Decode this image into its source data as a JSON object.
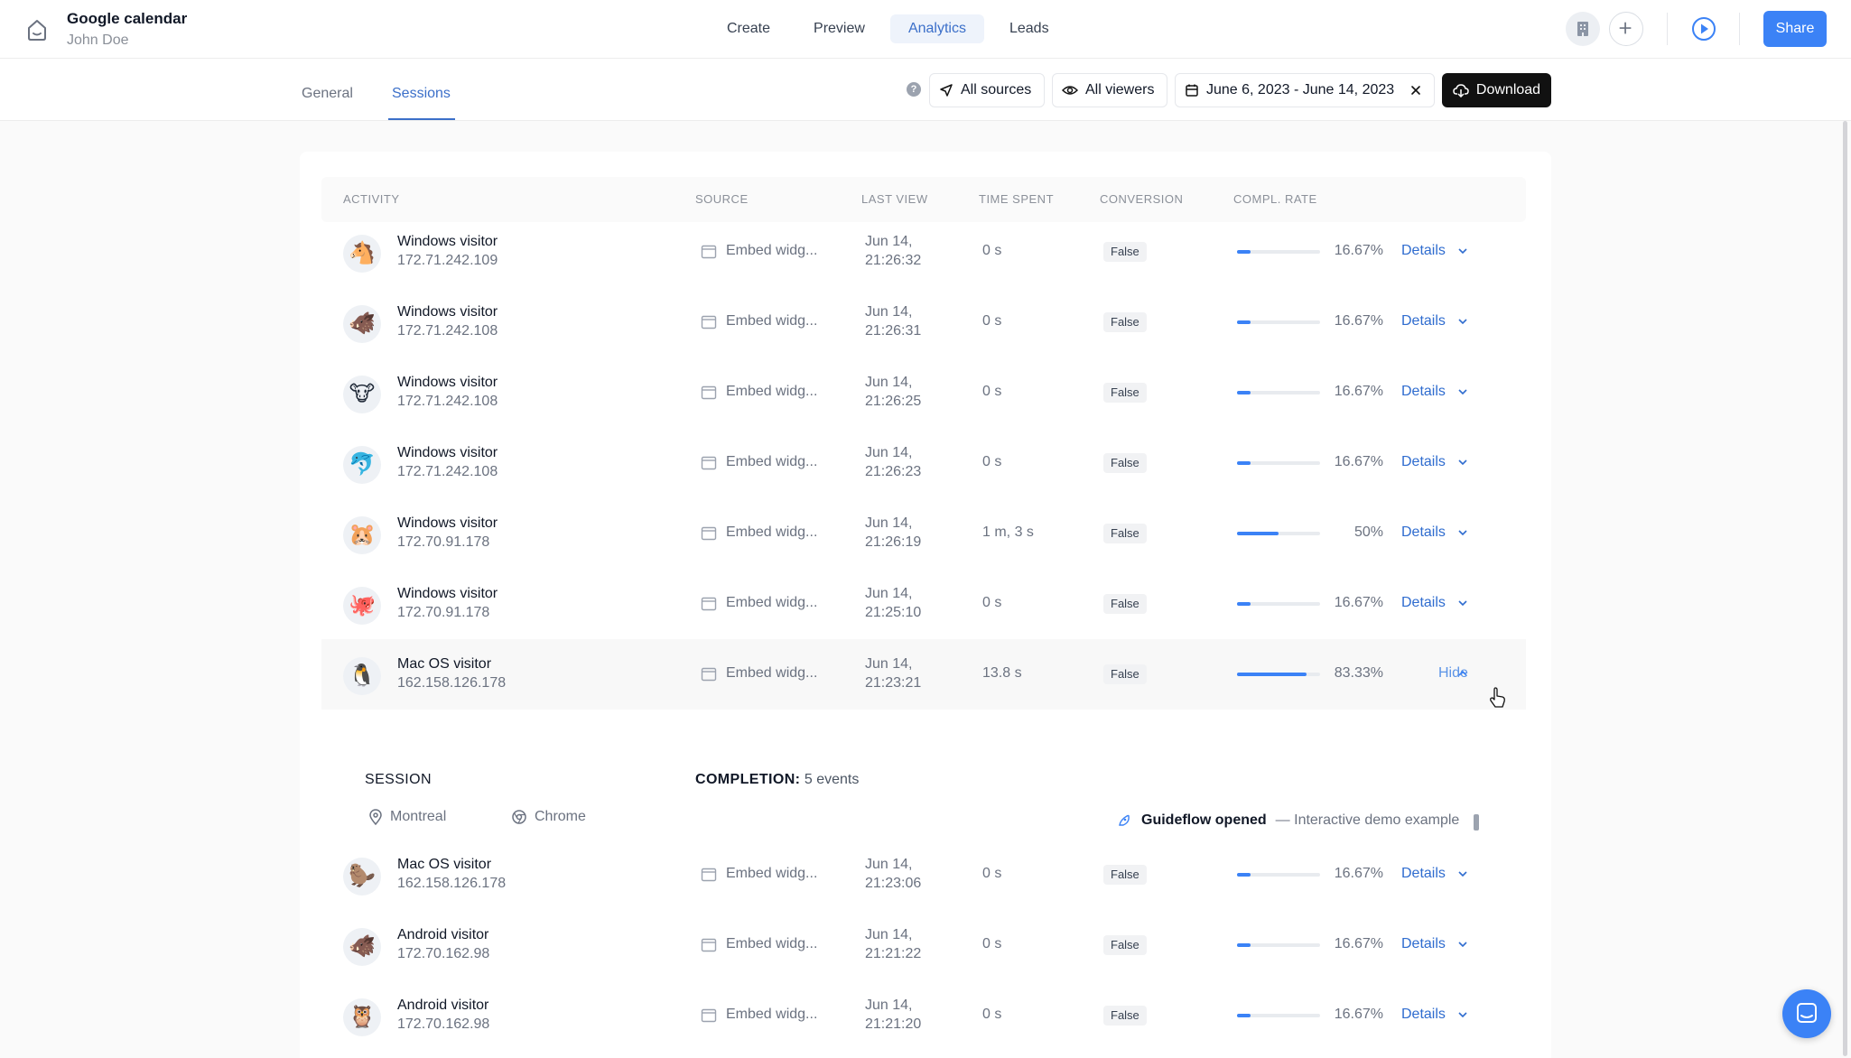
{
  "header": {
    "project_title": "Google calendar",
    "user_name": "John Doe",
    "tabs": [
      {
        "label": "Create",
        "active": false
      },
      {
        "label": "Preview",
        "active": false
      },
      {
        "label": "Analytics",
        "active": true
      },
      {
        "label": "Leads",
        "active": false
      }
    ],
    "share_label": "Share",
    "icons": [
      "home-icon",
      "building-icon",
      "plus-icon",
      "play-icon"
    ]
  },
  "subnav": {
    "tabs": [
      {
        "label": "General",
        "active": false
      },
      {
        "label": "Sessions",
        "active": true
      }
    ],
    "help_glyph": "?",
    "sources_label": "All sources",
    "viewers_label": "All viewers",
    "date_range": "June 6, 2023 - June 14, 2023",
    "download_label": "Download"
  },
  "table": {
    "headers": [
      "ACTIVITY",
      "SOURCE",
      "LAST VIEW",
      "TIME SPENT",
      "CONVERSION",
      "COMPL. RATE"
    ],
    "details_label": "Details",
    "hide_label": "Hide",
    "rows": [
      {
        "avatar": "🐴",
        "name": "Windows visitor",
        "ip": "172.71.242.109",
        "source": "Embed widg...",
        "date": "Jun 14,",
        "time": "21:26:32",
        "spent": "0 s",
        "conversion": "False",
        "rate": "16.67%",
        "progress": 0.1667,
        "expanded": false
      },
      {
        "avatar": "🐗",
        "name": "Windows visitor",
        "ip": "172.71.242.108",
        "source": "Embed widg...",
        "date": "Jun 14,",
        "time": "21:26:31",
        "spent": "0 s",
        "conversion": "False",
        "rate": "16.67%",
        "progress": 0.1667,
        "expanded": false
      },
      {
        "avatar": "🐮",
        "name": "Windows visitor",
        "ip": "172.71.242.108",
        "source": "Embed widg...",
        "date": "Jun 14,",
        "time": "21:26:25",
        "spent": "0 s",
        "conversion": "False",
        "rate": "16.67%",
        "progress": 0.1667,
        "expanded": false
      },
      {
        "avatar": "🐬",
        "name": "Windows visitor",
        "ip": "172.71.242.108",
        "source": "Embed widg...",
        "date": "Jun 14,",
        "time": "21:26:23",
        "spent": "0 s",
        "conversion": "False",
        "rate": "16.67%",
        "progress": 0.1667,
        "expanded": false
      },
      {
        "avatar": "🐹",
        "name": "Windows visitor",
        "ip": "172.70.91.178",
        "source": "Embed widg...",
        "date": "Jun 14,",
        "time": "21:26:19",
        "spent": "1 m, 3 s",
        "conversion": "False",
        "rate": "50%",
        "progress": 0.5,
        "expanded": false
      },
      {
        "avatar": "🐙",
        "name": "Windows visitor",
        "ip": "172.70.91.178",
        "source": "Embed widg...",
        "date": "Jun 14,",
        "time": "21:25:10",
        "spent": "0 s",
        "conversion": "False",
        "rate": "16.67%",
        "progress": 0.1667,
        "expanded": false
      },
      {
        "avatar": "🐧",
        "name": "Mac OS visitor",
        "ip": "162.158.126.178",
        "source": "Embed widg...",
        "date": "Jun 14,",
        "time": "21:23:21",
        "spent": "13.8 s",
        "conversion": "False",
        "rate": "83.33%",
        "progress": 0.8333,
        "expanded": true
      },
      {
        "avatar": "🦫",
        "name": "Mac OS visitor",
        "ip": "162.158.126.178",
        "source": "Embed widg...",
        "date": "Jun 14,",
        "time": "21:23:06",
        "spent": "0 s",
        "conversion": "False",
        "rate": "16.67%",
        "progress": 0.1667,
        "expanded": false
      },
      {
        "avatar": "🐗",
        "name": "Android visitor",
        "ip": "172.70.162.98",
        "source": "Embed widg...",
        "date": "Jun 14,",
        "time": "21:21:22",
        "spent": "0 s",
        "conversion": "False",
        "rate": "16.67%",
        "progress": 0.1667,
        "expanded": false
      },
      {
        "avatar": "🦉",
        "name": "Android visitor",
        "ip": "172.70.162.98",
        "source": "Embed widg...",
        "date": "Jun 14,",
        "time": "21:21:20",
        "spent": "0 s",
        "conversion": "False",
        "rate": "16.67%",
        "progress": 0.1667,
        "expanded": false
      }
    ]
  },
  "session": {
    "title": "SESSION",
    "completion_label": "COMPLETION:",
    "completion_value": "5 events",
    "location": "Montreal",
    "browser": "Chrome",
    "event_title": "Guideflow opened",
    "event_desc": "— Interactive demo example"
  },
  "colors": {
    "accent": "#3b82f6",
    "link": "#2f6ccf",
    "dark_button": "#111111"
  }
}
